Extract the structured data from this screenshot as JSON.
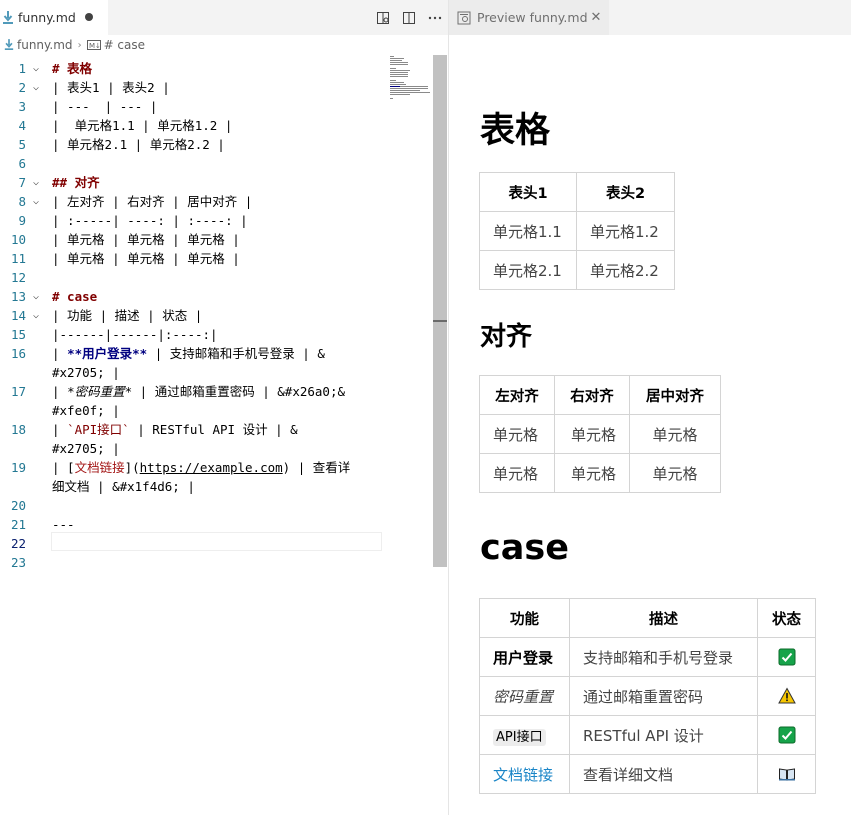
{
  "editor": {
    "tab_title": "funny.md",
    "breadcrumb": {
      "file": "funny.md",
      "symbol": "# case"
    },
    "lines": [
      {
        "n": "1",
        "fold": true,
        "parts": [
          {
            "t": "# 表格",
            "c": "hd"
          }
        ]
      },
      {
        "n": "2",
        "fold": true,
        "parts": [
          {
            "t": "| 表头1 | 表头2 |"
          }
        ]
      },
      {
        "n": "3",
        "parts": [
          {
            "t": "| ---  | --- |"
          }
        ]
      },
      {
        "n": "4",
        "parts": [
          {
            "t": "|  单元格1.1 | 单元格1.2 |"
          }
        ]
      },
      {
        "n": "5",
        "parts": [
          {
            "t": "| 单元格2.1 | 单元格2.2 |"
          }
        ]
      },
      {
        "n": "6",
        "parts": []
      },
      {
        "n": "7",
        "fold": true,
        "parts": [
          {
            "t": "## 对齐",
            "c": "hd"
          }
        ]
      },
      {
        "n": "8",
        "fold": true,
        "parts": [
          {
            "t": "| 左对齐 | 右对齐 | 居中对齐 |"
          }
        ]
      },
      {
        "n": "9",
        "parts": [
          {
            "t": "| :-----| ----: | :----: |"
          }
        ]
      },
      {
        "n": "10",
        "parts": [
          {
            "t": "| 单元格 | 单元格 | 单元格 |"
          }
        ]
      },
      {
        "n": "11",
        "parts": [
          {
            "t": "| 单元格 | 单元格 | 单元格 |"
          }
        ]
      },
      {
        "n": "12",
        "parts": []
      },
      {
        "n": "13",
        "fold": true,
        "parts": [
          {
            "t": "# case",
            "c": "hd"
          }
        ]
      },
      {
        "n": "14",
        "fold": true,
        "parts": [
          {
            "t": "| 功能 | 描述 | 状态 |"
          }
        ]
      },
      {
        "n": "15",
        "parts": [
          {
            "t": "|------|------|:----:|"
          }
        ]
      },
      {
        "n": "16",
        "parts": [
          {
            "t": "| "
          },
          {
            "t": "**用户登录**",
            "c": "bold"
          },
          {
            "t": " | 支持邮箱和手机号登录 | &"
          }
        ]
      },
      {
        "n": "",
        "parts": [
          {
            "t": "#x2705; |"
          }
        ]
      },
      {
        "n": "17",
        "parts": [
          {
            "t": "| "
          },
          {
            "t": "*密码重置*",
            "c": "ital"
          },
          {
            "t": " | 通过邮箱重置密码 | &#x26a0;&"
          }
        ]
      },
      {
        "n": "",
        "parts": [
          {
            "t": "#xfe0f; |"
          }
        ]
      },
      {
        "n": "18",
        "parts": [
          {
            "t": "| "
          },
          {
            "t": "`API接口`",
            "c": "codeTk"
          },
          {
            "t": " | RESTful API 设计 | &"
          }
        ]
      },
      {
        "n": "",
        "parts": [
          {
            "t": "#x2705; |"
          }
        ]
      },
      {
        "n": "19",
        "parts": [
          {
            "t": "| ["
          },
          {
            "t": "文档链接",
            "c": "linkTx"
          },
          {
            "t": "]("
          },
          {
            "t": "https://example.com",
            "c": "url"
          },
          {
            "t": ") | 查看详"
          }
        ]
      },
      {
        "n": "",
        "parts": [
          {
            "t": "细文档 | &#x1f4d6; |"
          }
        ]
      },
      {
        "n": "20",
        "parts": []
      },
      {
        "n": "21",
        "parts": [
          {
            "t": "---"
          }
        ]
      },
      {
        "n": "22",
        "current": true,
        "parts": []
      },
      {
        "n": "23",
        "parts": []
      }
    ]
  },
  "preview": {
    "tab_title": "Preview funny.md",
    "h1_table": "表格",
    "table1": {
      "headers": [
        "表头1",
        "表头2"
      ],
      "rows": [
        [
          "单元格1.1",
          "单元格1.2"
        ],
        [
          "单元格2.1",
          "单元格2.2"
        ]
      ]
    },
    "h2_align": "对齐",
    "table2": {
      "headers": [
        "左对齐",
        "右对齐",
        "居中对齐"
      ],
      "rows": [
        [
          "单元格",
          "单元格",
          "单元格"
        ],
        [
          "单元格",
          "单元格",
          "单元格"
        ]
      ]
    },
    "h1_case": "case",
    "table3": {
      "headers": [
        "功能",
        "描述",
        "状态"
      ],
      "rows": [
        {
          "feature": "用户登录",
          "style": "bold",
          "desc": "支持邮箱和手机号登录",
          "status_icon": "check-mark-icon"
        },
        {
          "feature": "密码重置",
          "style": "italic",
          "desc": "通过邮箱重置密码",
          "status_icon": "warning-icon"
        },
        {
          "feature": "API接口",
          "style": "code",
          "desc": "RESTful API 设计",
          "status_icon": "check-mark-icon"
        },
        {
          "feature": "文档链接",
          "style": "link",
          "desc": "查看详细文档",
          "status_icon": "open-book-icon"
        }
      ]
    }
  },
  "colors": {
    "heading_token": "#800000",
    "bold_token": "#000080",
    "line_number": "#237893",
    "link": "#1a85c7",
    "check_green": "#16a34a",
    "warning_yellow": "#f7c600"
  }
}
